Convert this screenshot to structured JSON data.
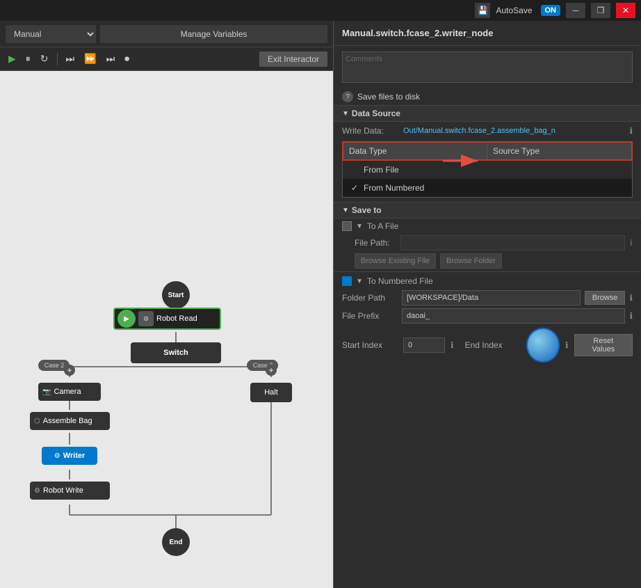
{
  "titlebar": {
    "autosave_label": "AutoSave",
    "autosave_state": "ON",
    "minimize_label": "─",
    "maximize_label": "❐",
    "close_label": "✕"
  },
  "left_toolbar": {
    "mode": "Manual",
    "manage_vars_label": "Manage Variables",
    "exit_label": "Exit Interactor"
  },
  "right_panel": {
    "title": "Manual.switch.fcase_2.writer_node",
    "comments_placeholder": "Comments",
    "save_files_label": "Save files to disk",
    "data_source_label": "Data Source",
    "write_data_label": "Write Data:",
    "write_data_value": "Out/Manual.switch.fcase_2.assemble_bag_n",
    "data_type_label": "Data Type",
    "source_type_label": "Source Type",
    "dropdown": {
      "col1_header": "Data Type",
      "col2_header": "Source Type",
      "items": [
        {
          "label": "From File",
          "active": false
        },
        {
          "label": "From Numbered",
          "active": true
        }
      ]
    },
    "save_to_label": "Save to",
    "to_a_file_label": "To A File",
    "file_path_label": "File Path:",
    "browse_existing_label": "Browse Existing File",
    "browse_folder_label": "Browse Folder",
    "to_numbered_label": "To Numbered File",
    "folder_path_label": "Folder Path",
    "folder_path_value": "[WORKSPACE]/Data",
    "browse_label": "Browse",
    "file_prefix_label": "File Prefix",
    "file_prefix_value": "daoai_",
    "start_index_label": "Start Index",
    "start_index_value": "0",
    "end_index_label": "End Index",
    "reset_values_label": "Reset Values"
  },
  "flow_nodes": {
    "start_label": "Start",
    "end_label": "End",
    "robot_read_label": "Robot Read",
    "switch_label": "Switch",
    "camera_label": "Camera",
    "assemble_bag_label": "Assemble Bag",
    "writer_label": "Writer",
    "robot_write_label": "Robot Write",
    "halt_label": "Halt",
    "case2_label": "Case 2",
    "case3_label": "Case 3"
  }
}
